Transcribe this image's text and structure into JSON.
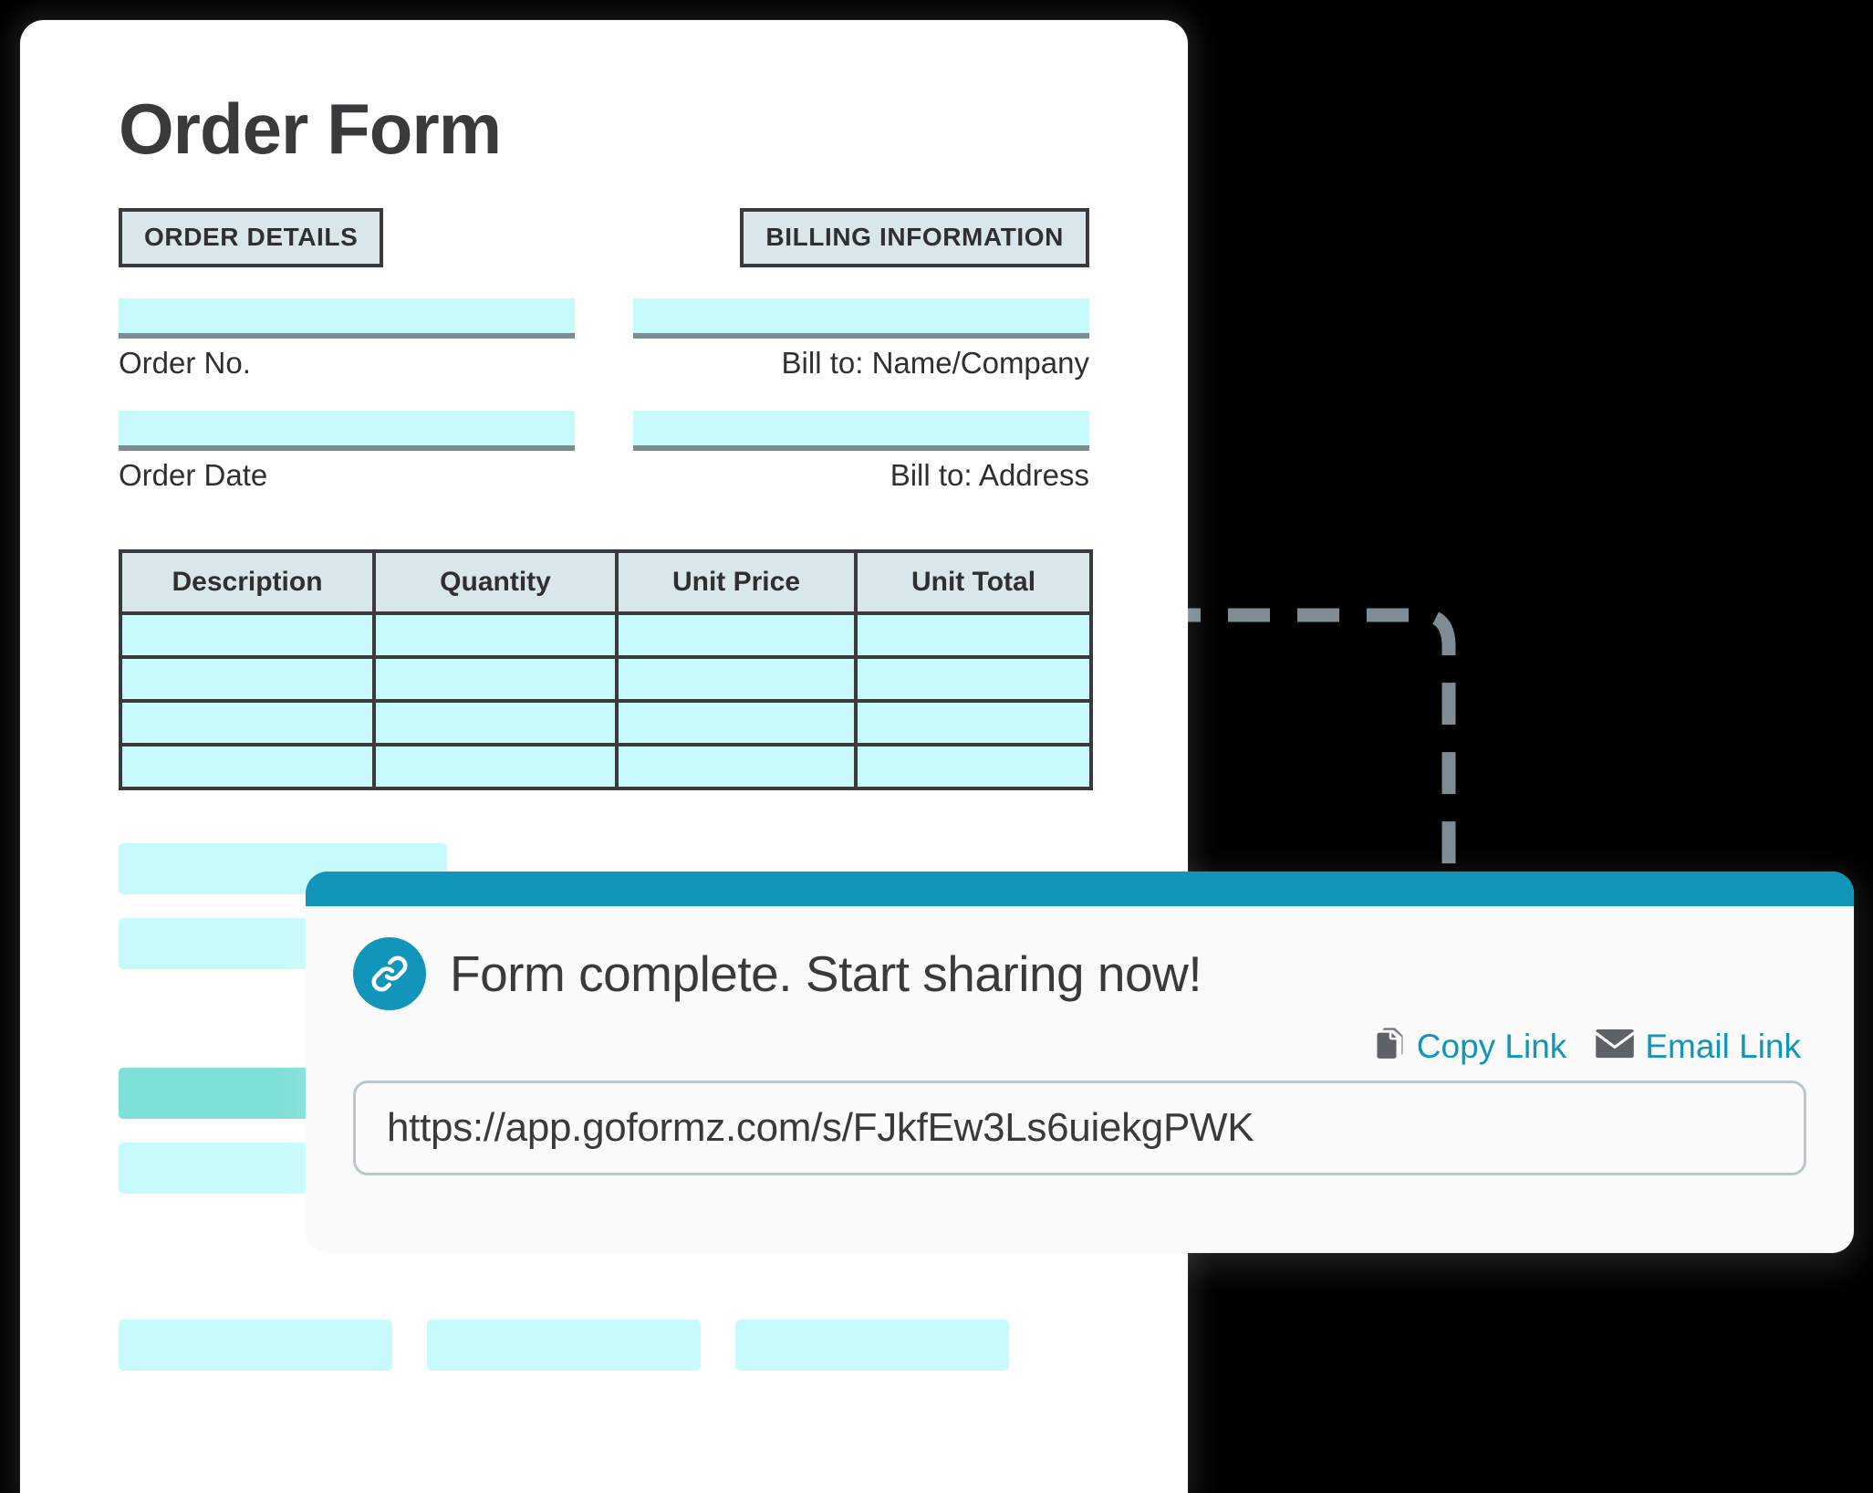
{
  "form": {
    "title": "Order Form",
    "sections": {
      "order_details": "ORDER DETAILS",
      "billing_information": "BILLING INFORMATION"
    },
    "fields": {
      "order_no": {
        "label": "Order No.",
        "value": ""
      },
      "order_date": {
        "label": "Order Date",
        "value": ""
      },
      "bill_to_name": {
        "label": "Bill to: Name/Company",
        "value": ""
      },
      "bill_to_address": {
        "label": "Bill to: Address",
        "value": ""
      }
    },
    "items_table": {
      "headers": [
        "Description",
        "Quantity",
        "Unit Price",
        "Unit Total"
      ],
      "rows": [
        [
          "",
          "",
          "",
          ""
        ],
        [
          "",
          "",
          "",
          ""
        ],
        [
          "",
          "",
          "",
          ""
        ],
        [
          "",
          "",
          "",
          ""
        ]
      ]
    },
    "placeholder_blocks": {
      "stacked": [
        {
          "state": "empty"
        },
        {
          "state": "empty"
        },
        {
          "state": "filled"
        },
        {
          "state": "empty"
        }
      ],
      "bottom_row": [
        {
          "state": "empty"
        },
        {
          "state": "empty"
        },
        {
          "state": "empty"
        }
      ]
    }
  },
  "share_card": {
    "title": "Form complete. Start sharing now!",
    "link_icon": "link-chain-icon",
    "actions": [
      {
        "icon": "copy-document-icon",
        "label": "Copy Link"
      },
      {
        "icon": "envelope-icon",
        "label": "Email Link"
      }
    ],
    "url_field": {
      "value": "https://app.goformz.com/s/FJkfEw3Ls6uiekgPWK",
      "placeholder": "Share link"
    }
  },
  "colors": {
    "accent_teal": "#1295ba",
    "field_cyan": "#c7fbfb",
    "field_cyan_filled": "#7fe0d8",
    "section_chip_bg": "#d9e7ec",
    "ink": "#3a3a3c",
    "connector_gray": "#7f8c94"
  }
}
